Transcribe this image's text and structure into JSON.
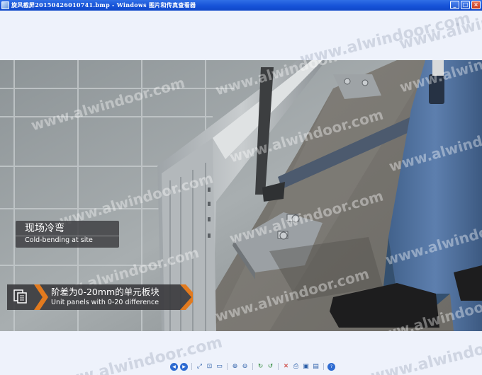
{
  "window": {
    "title": "旋风截屏20150426010741.bmp - Windows 图片和传真查看器",
    "buttons": {
      "minimize": "_",
      "maximize": "□",
      "close": "×"
    }
  },
  "image": {
    "watermark": "www.alwindoor.com",
    "caption": {
      "cn": "现场冷弯",
      "en": "Cold-bending at site"
    },
    "banner": {
      "cn": "阶差为0-20mm的单元板块",
      "en": "Unit panels with 0-20 difference",
      "accent_color": "#e27a1e",
      "bg_color": "#3a3a3d"
    }
  },
  "toolbar": {
    "buttons": [
      {
        "id": "prev",
        "icon": "prev-image-icon",
        "glyph": "◀"
      },
      {
        "id": "next",
        "icon": "next-image-icon",
        "glyph": "▶"
      },
      {
        "id": "best-fit",
        "icon": "best-fit-icon",
        "glyph": "⤢"
      },
      {
        "id": "actual-size",
        "icon": "actual-size-icon",
        "glyph": "⊡"
      },
      {
        "id": "slideshow",
        "icon": "slideshow-icon",
        "glyph": "▭"
      },
      {
        "id": "zoom-in",
        "icon": "zoom-in-icon",
        "glyph": "⊕"
      },
      {
        "id": "zoom-out",
        "icon": "zoom-out-icon",
        "glyph": "⊖"
      },
      {
        "id": "rotate-cw",
        "icon": "rotate-clockwise-icon",
        "glyph": "↻"
      },
      {
        "id": "rotate-ccw",
        "icon": "rotate-counterclockwise-icon",
        "glyph": "↺"
      },
      {
        "id": "delete",
        "icon": "delete-icon",
        "glyph": "✕"
      },
      {
        "id": "print",
        "icon": "print-icon",
        "glyph": "⎙"
      },
      {
        "id": "save",
        "icon": "save-icon",
        "glyph": "▣"
      },
      {
        "id": "open",
        "icon": "open-icon",
        "glyph": "▤"
      },
      {
        "id": "help",
        "icon": "help-icon",
        "glyph": "?"
      }
    ]
  }
}
